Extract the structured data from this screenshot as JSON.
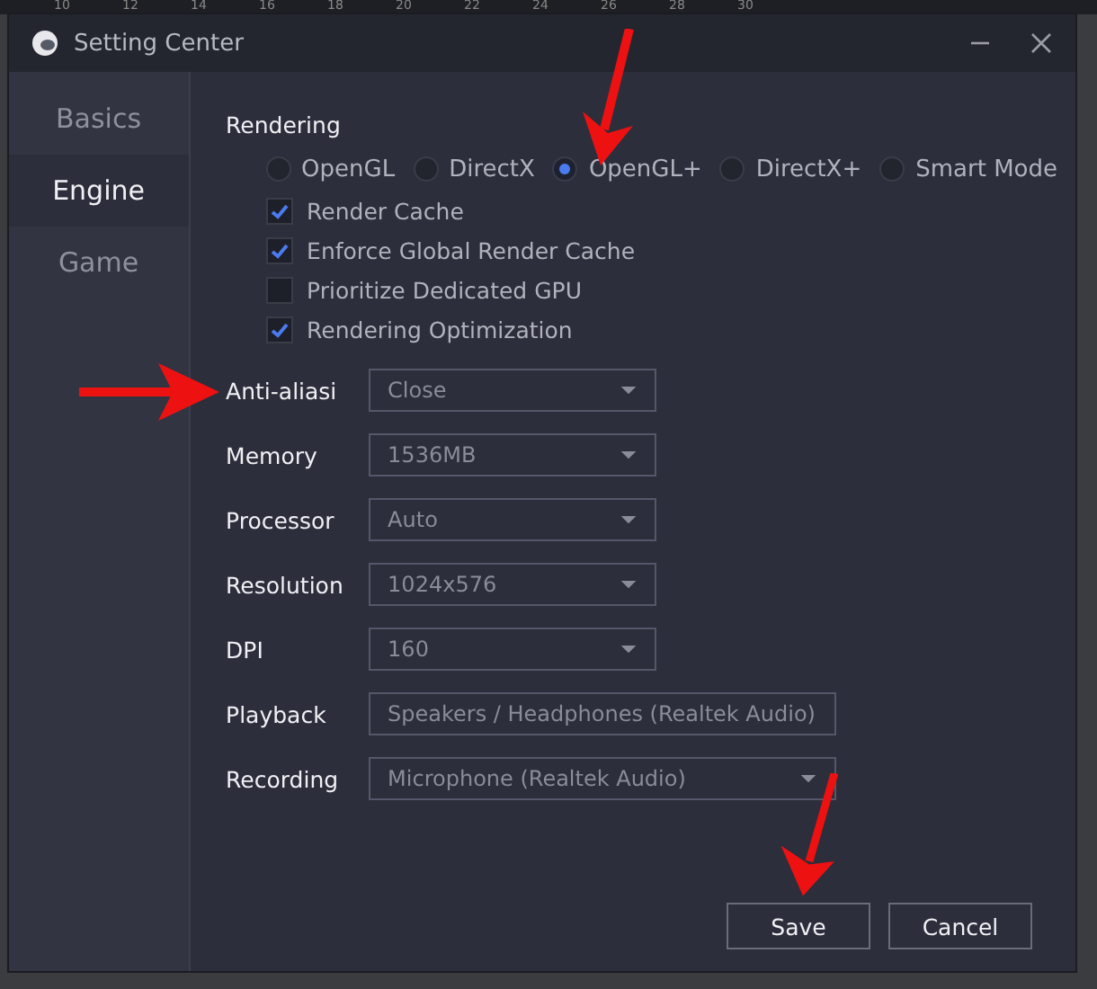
{
  "ruler": {
    "labels": [
      "10",
      "12",
      "14",
      "16",
      "18",
      "20",
      "22",
      "24",
      "26",
      "28",
      "30"
    ]
  },
  "window": {
    "title": "Setting Center"
  },
  "sidebar": {
    "items": [
      {
        "label": "Basics",
        "selected": false
      },
      {
        "label": "Engine",
        "selected": true
      },
      {
        "label": "Game",
        "selected": false
      }
    ]
  },
  "rendering": {
    "title": "Rendering",
    "modes": [
      {
        "label": "OpenGL",
        "selected": false
      },
      {
        "label": "DirectX",
        "selected": false
      },
      {
        "label": "OpenGL+",
        "selected": true
      },
      {
        "label": "DirectX+",
        "selected": false
      },
      {
        "label": "Smart Mode",
        "selected": false
      }
    ],
    "options": [
      {
        "label": "Render Cache",
        "checked": true
      },
      {
        "label": "Enforce Global Render Cache",
        "checked": true
      },
      {
        "label": "Prioritize Dedicated GPU",
        "checked": false
      },
      {
        "label": "Rendering Optimization",
        "checked": true
      }
    ]
  },
  "settings": [
    {
      "label": "Anti-aliasi",
      "value": "Close",
      "kind": "narrow"
    },
    {
      "label": "Memory",
      "value": "1536MB",
      "kind": "narrow"
    },
    {
      "label": "Processor",
      "value": "Auto",
      "kind": "narrow"
    },
    {
      "label": "Resolution",
      "value": "1024x576",
      "kind": "narrow"
    },
    {
      "label": "DPI",
      "value": "160",
      "kind": "narrow"
    },
    {
      "label": "Playback",
      "value": "Speakers / Headphones (Realtek Audio)",
      "kind": "wide"
    },
    {
      "label": "Recording",
      "value": "Microphone (Realtek Audio)",
      "kind": "wide"
    }
  ],
  "buttons": [
    "Save",
    "Cancel"
  ]
}
